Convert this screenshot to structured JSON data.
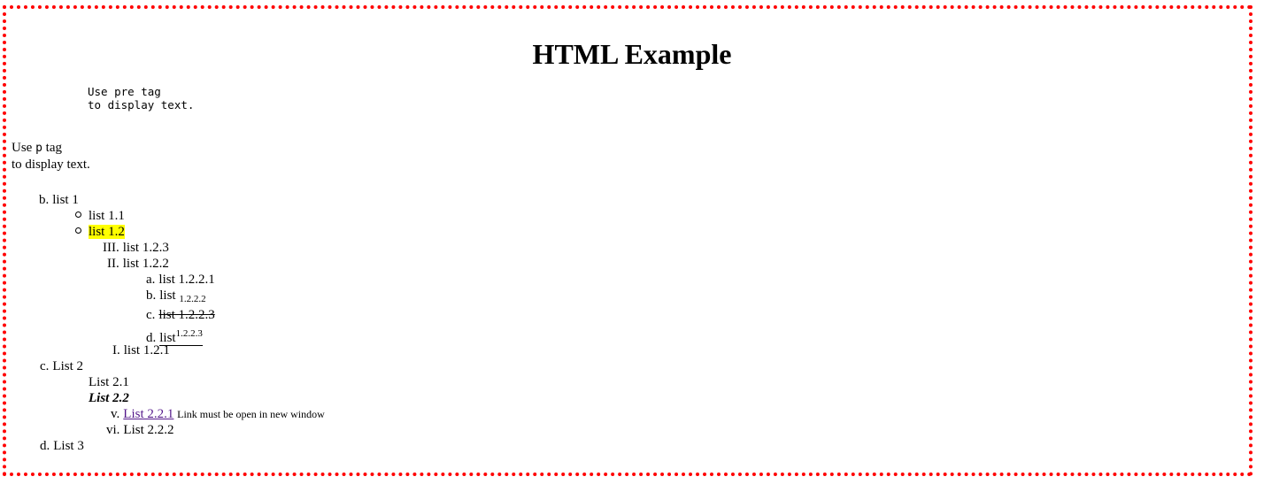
{
  "page": {
    "title": "HTML Example",
    "border_color": "#ff0000",
    "pre_text": "Use pre tag\nto display text.",
    "para": {
      "line1_prefix": "Use ",
      "line1_tag": "p",
      "line1_suffix": " tag",
      "line2": "to display text."
    }
  },
  "list": {
    "item_b": {
      "marker": "b.",
      "label": "list 1"
    },
    "item_1_1": {
      "label": "list 1.1"
    },
    "item_1_2": {
      "label": "list 1.2",
      "highlight": "#ffff00"
    },
    "item_1_2_3": {
      "marker": "III.",
      "label": "list 1.2.3"
    },
    "item_1_2_2": {
      "marker": "II.",
      "label": "list 1.2.2"
    },
    "item_a": {
      "marker": "a.",
      "label": "list 1.2.2.1"
    },
    "item_b2": {
      "marker": "b.",
      "label": "list",
      "sub": "1.2.2.2"
    },
    "item_c2": {
      "marker": "c.",
      "label": "list 1.2.2.3"
    },
    "item_d2": {
      "marker": "d.",
      "label": "list",
      "sup": "1.2.2.3"
    },
    "item_1_2_1": {
      "marker": "I.",
      "label": "list 1.2.1"
    },
    "item_c": {
      "marker": "c.",
      "label": "List 2"
    },
    "item_2_1": {
      "label": "List 2.1"
    },
    "item_2_2": {
      "label": "List 2.2"
    },
    "item_v": {
      "marker": "v.",
      "link": "List 2.2.1",
      "note": "Link must be open in new window"
    },
    "item_vi": {
      "marker": "vi.",
      "label": "List 2.2.2"
    },
    "item_d": {
      "marker": "d.",
      "label": "List 3"
    }
  }
}
